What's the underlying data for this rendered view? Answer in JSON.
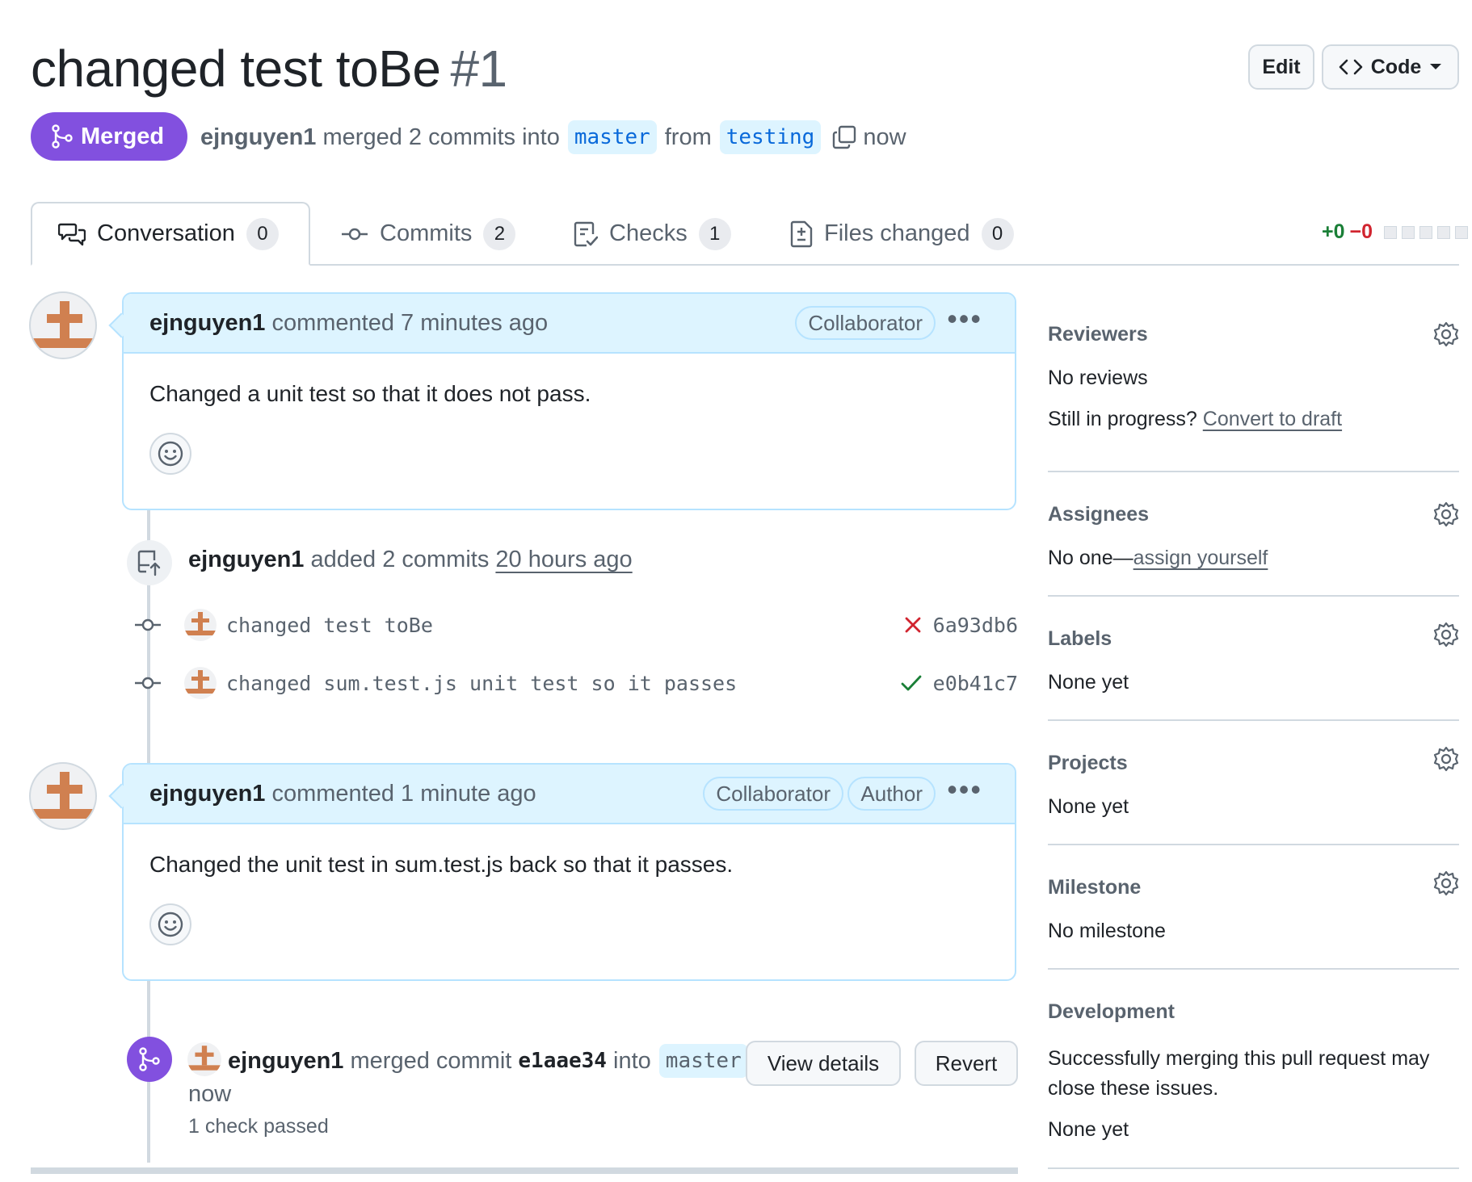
{
  "pr": {
    "title": "changed test toBe",
    "number": "#1",
    "status": "Merged",
    "author": "ejnguyen1",
    "merge_text": "merged 2 commits into",
    "base_branch": "master",
    "from_text": "from",
    "head_branch": "testing",
    "time": "now"
  },
  "header_buttons": {
    "edit": "Edit",
    "code": "Code"
  },
  "tabs": [
    {
      "label": "Conversation",
      "count": "0",
      "icon": "comment-discussion-icon"
    },
    {
      "label": "Commits",
      "count": "2",
      "icon": "git-commit-icon"
    },
    {
      "label": "Checks",
      "count": "1",
      "icon": "checklist-icon"
    },
    {
      "label": "Files changed",
      "count": "0",
      "icon": "file-diff-icon"
    }
  ],
  "diffstat": {
    "additions": "+0",
    "deletions": "−0"
  },
  "comments": [
    {
      "user": "ejnguyen1",
      "action": "commented 7 minutes ago",
      "labels": [
        "Collaborator"
      ],
      "body": "Changed a unit test so that it does not pass."
    },
    {
      "user": "ejnguyen1",
      "action": "commented 1 minute ago",
      "labels": [
        "Collaborator",
        "Author"
      ],
      "body": "Changed the unit test in sum.test.js back so that it passes."
    }
  ],
  "commits_event": {
    "user": "ejnguyen1",
    "text": "added 2 commits",
    "time": "20 hours ago",
    "commits": [
      {
        "message": "changed test toBe",
        "sha": "6a93db6",
        "status": "failure"
      },
      {
        "message": "changed sum.test.js unit test so it passes",
        "sha": "e0b41c7",
        "status": "success"
      }
    ]
  },
  "merge_event": {
    "user": "ejnguyen1",
    "text": "merged commit",
    "sha": "e1aae34",
    "into_text": "into",
    "branch": "master",
    "time": "now",
    "checks": "1 check passed",
    "view_details": "View details",
    "revert": "Revert"
  },
  "sidebar": {
    "reviewers": {
      "title": "Reviewers",
      "value": "No reviews",
      "progress_text": "Still in progress?",
      "progress_link": "Convert to draft"
    },
    "assignees": {
      "title": "Assignees",
      "value": "No one—",
      "link": "assign yourself"
    },
    "labels": {
      "title": "Labels",
      "value": "None yet"
    },
    "projects": {
      "title": "Projects",
      "value": "None yet"
    },
    "milestone": {
      "title": "Milestone",
      "value": "No milestone"
    },
    "development": {
      "title": "Development",
      "line1": "Successfully merging this pull request may",
      "line2": "close these issues.",
      "value": "None yet"
    }
  },
  "colors": {
    "merged": "#8250df",
    "link": "#0969da",
    "success": "#1a7f37",
    "danger": "#d1242f",
    "comment_header": "#ddf4ff",
    "avatar": "#d08050"
  }
}
